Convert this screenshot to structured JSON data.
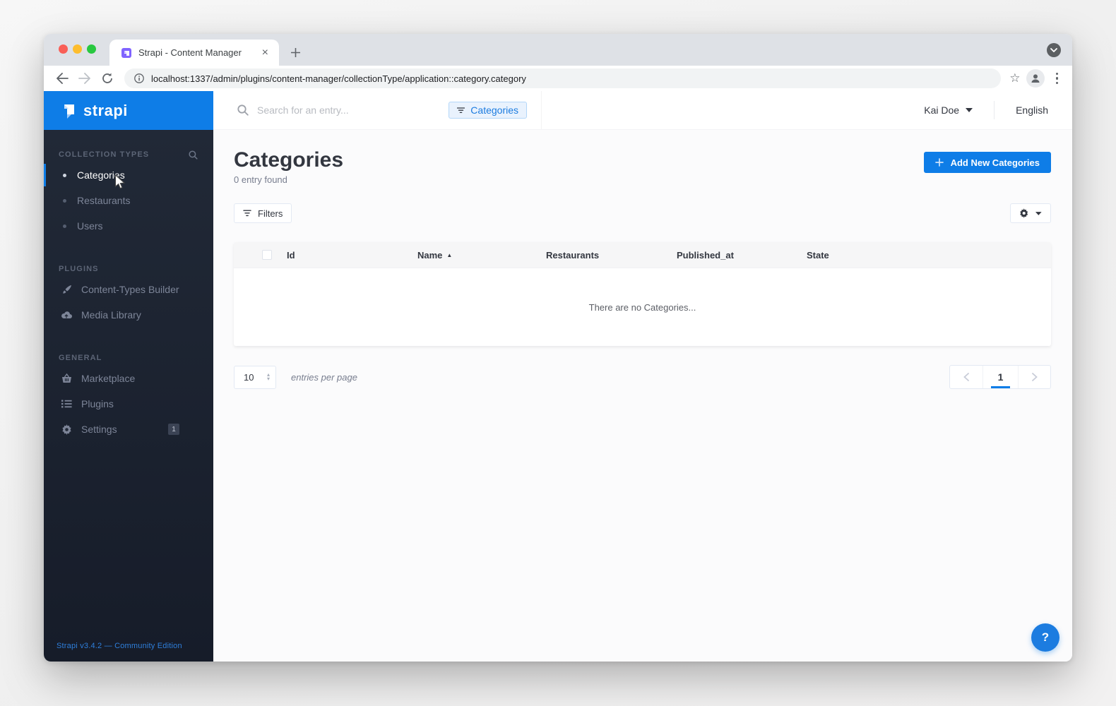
{
  "glyphs": {
    "close": "×",
    "star": "☆",
    "help": "?",
    "sort_asc": "▲",
    "stepper_up": "▴",
    "stepper_down": "▾"
  },
  "browser": {
    "tab_title": "Strapi - Content Manager",
    "url": "localhost:1337/admin/plugins/content-manager/collectionType/application::category.category"
  },
  "header": {
    "search_placeholder": "Search for an entry...",
    "filter_chip": "Categories",
    "user_name": "Kai Doe",
    "language": "English"
  },
  "sidebar": {
    "logo_text": "strapi",
    "sections": [
      {
        "label": "COLLECTION TYPES",
        "items": [
          {
            "label": "Categories"
          },
          {
            "label": "Restaurants"
          },
          {
            "label": "Users"
          }
        ]
      },
      {
        "label": "PLUGINS",
        "items": [
          {
            "label": "Content-Types Builder"
          },
          {
            "label": "Media Library"
          }
        ]
      },
      {
        "label": "GENERAL",
        "items": [
          {
            "label": "Marketplace"
          },
          {
            "label": "Plugins"
          },
          {
            "label": "Settings",
            "badge": "1"
          }
        ]
      }
    ],
    "footer": "Strapi v3.4.2 — Community Edition"
  },
  "main": {
    "title": "Categories",
    "subtitle": "0 entry found",
    "add_button_label": "Add New Categories",
    "filters_button_label": "Filters",
    "table": {
      "columns": [
        "Id",
        "Name",
        "Restaurants",
        "Published_at",
        "State"
      ],
      "sorted_column": "Name",
      "sort_direction": "asc",
      "empty_message": "There are no Categories...",
      "rows": []
    },
    "pagination": {
      "per_page": "10",
      "per_page_label": "entries per page",
      "current_page": "1"
    }
  },
  "colors": {
    "accent_blue": "#0e7de7",
    "sidebar_top": "#222a38",
    "sidebar_bottom": "#161c29",
    "chip_text": "#1c7ce0",
    "tabstrip": "#dee1e6"
  }
}
